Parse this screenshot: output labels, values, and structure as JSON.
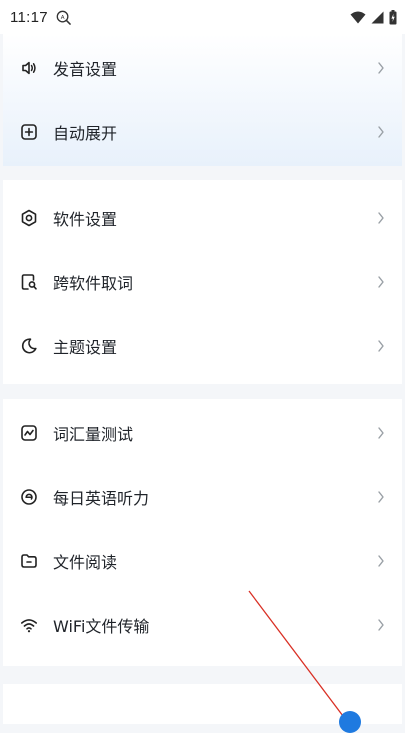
{
  "status_bar": {
    "time": "11:17",
    "app_icon": "translate-notification-icon",
    "signal_icons": [
      "wifi-icon",
      "cellular-signal-icon",
      "battery-charging-icon"
    ]
  },
  "sections": [
    {
      "items": [
        {
          "label": "发音设置",
          "icon": "speaker-icon"
        },
        {
          "label": "自动展开",
          "icon": "plus-square-icon"
        }
      ]
    },
    {
      "items": [
        {
          "label": "软件设置",
          "icon": "hexagon-settings-icon"
        },
        {
          "label": "跨软件取词",
          "icon": "document-search-icon"
        },
        {
          "label": "主题设置",
          "icon": "moon-icon"
        }
      ]
    },
    {
      "items": [
        {
          "label": "词汇量测试",
          "icon": "chart-square-icon"
        },
        {
          "label": "每日英语听力",
          "icon": "circle-e-icon"
        },
        {
          "label": "文件阅读",
          "icon": "folder-icon"
        },
        {
          "label": "WiFi文件传输",
          "icon": "wifi-icon"
        }
      ]
    }
  ],
  "colors": {
    "accent": "#1f7ae0",
    "annotation": "#d93025",
    "background": "#f4f6f9"
  }
}
